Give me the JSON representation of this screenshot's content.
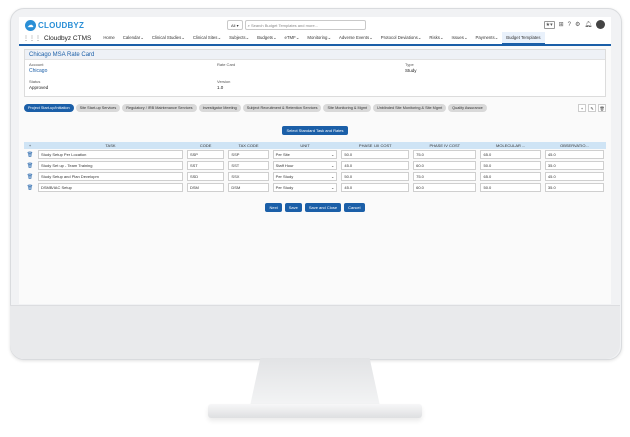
{
  "app": {
    "brand": "CLOUDBYZ",
    "name": "Cloudbyz CTMS",
    "accent": "#1b5fa8"
  },
  "search": {
    "scope": "All",
    "placeholder": "Search Budget Templates and more..."
  },
  "nav": {
    "items": [
      {
        "label": "Home",
        "active": false
      },
      {
        "label": "Calendar",
        "active": false
      },
      {
        "label": "Clinical Studies",
        "active": false
      },
      {
        "label": "Clinical Sites",
        "active": false
      },
      {
        "label": "Subjects",
        "active": false
      },
      {
        "label": "Budgets",
        "active": false
      },
      {
        "label": "eTMF",
        "active": false
      },
      {
        "label": "Monitoring",
        "active": false
      },
      {
        "label": "Adverse Events",
        "active": false
      },
      {
        "label": "Protocol Deviations",
        "active": false
      },
      {
        "label": "Risks",
        "active": false
      },
      {
        "label": "Issues",
        "active": false
      },
      {
        "label": "Payments",
        "active": false
      },
      {
        "label": "Budget Templates",
        "active": true
      }
    ]
  },
  "record": {
    "title": "Chicago MSA Rate Card",
    "account_label": "Account",
    "account_value": "Chicago",
    "ratecard_label": "Rate Card",
    "type_label": "Type",
    "type_value": "Study",
    "status_label": "Status",
    "status_value": "Approved",
    "version_label": "Version",
    "version_value": "1.0"
  },
  "tabs": [
    {
      "label": "Project Start-up/Initiation",
      "active": true
    },
    {
      "label": "Site Start-up Services",
      "active": false
    },
    {
      "label": "Regulatory / IRB Maintenance Services",
      "active": false
    },
    {
      "label": "Investigator Meeting",
      "active": false
    },
    {
      "label": "Subject Recruitment & Retention Services",
      "active": false
    },
    {
      "label": "Site Monitoring & Mgmt",
      "active": false
    },
    {
      "label": "Unblinded Site Monitoring & Site Mgmt",
      "active": false
    },
    {
      "label": "Quality Assurance",
      "active": false
    }
  ],
  "select_button": "Select Standard Task and Rates",
  "table": {
    "headers": [
      "TASK",
      "CODE",
      "TAX CODE",
      "UNIT",
      "PHASE I-III COST",
      "PHASE IV COST",
      "MOLECULAR ...",
      "OBSERVATIO..."
    ],
    "rows": [
      {
        "task": "Study Setup Per Location",
        "code": "SSP",
        "tax": "SSP",
        "unit": "Per Site",
        "p13": "50.0",
        "p4": "75.0",
        "mol": "65.0",
        "obs": "45.0"
      },
      {
        "task": "Study Set up - Team Training",
        "code": "SST",
        "tax": "SST",
        "unit": "Staff Hour",
        "p13": "45.0",
        "p4": "60.0",
        "mol": "50.0",
        "obs": "35.0"
      },
      {
        "task": "Study Setup and Plan Developm",
        "code": "SSD",
        "tax": "SSX",
        "unit": "Per Study",
        "p13": "50.0",
        "p4": "75.0",
        "mol": "65.0",
        "obs": "45.0"
      },
      {
        "task": "DSMB/IAC Setup",
        "code": "DSM",
        "tax": "DSM",
        "unit": "Per Study",
        "p13": "45.0",
        "p4": "60.0",
        "mol": "50.0",
        "obs": "35.0"
      }
    ]
  },
  "actions": {
    "next": "Next",
    "save": "Save",
    "save_close": "Save and Close",
    "cancel": "Cancel"
  }
}
